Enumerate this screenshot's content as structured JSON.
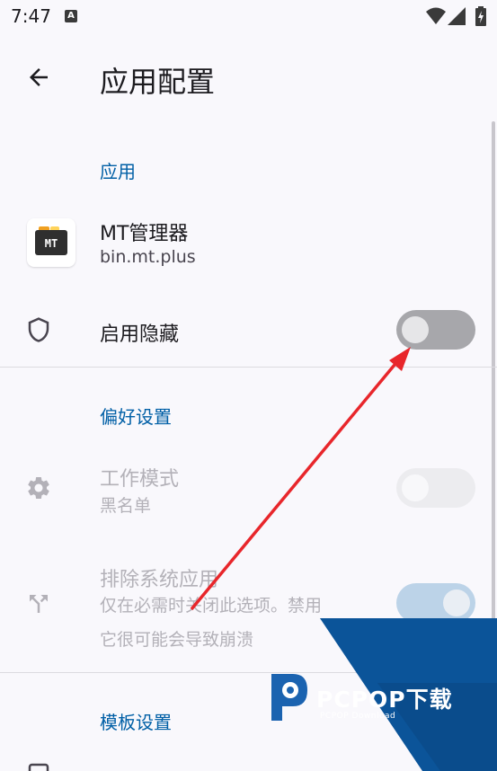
{
  "status_bar": {
    "time": "7:47",
    "notification_badge": "A"
  },
  "app_bar": {
    "title": "应用配置",
    "back_icon": "arrow-left-icon"
  },
  "sections": {
    "app": {
      "header": "应用",
      "app_name": "MT管理器",
      "package": "bin.mt.plus",
      "app_icon_text": "MT",
      "enable_hide": {
        "label": "启用隐藏",
        "icon": "shield-icon",
        "checked": false
      }
    },
    "preferences": {
      "header": "偏好设置",
      "work_mode": {
        "label": "工作模式",
        "value": "黑名单",
        "icon": "gear-icon",
        "checked": false,
        "enabled": false
      },
      "exclude_system": {
        "label": "排除系统应用",
        "description_line1": "仅在必需时关闭此选项。禁用",
        "description_line2": "它很可能会导致崩溃",
        "icon": "call-split-icon",
        "checked": true,
        "enabled": false
      }
    },
    "templates": {
      "header": "模板设置"
    }
  },
  "watermark": {
    "brand": "PCPOP下载",
    "sub": "PCPOP Download"
  },
  "colors": {
    "accent": "#005fa6",
    "annotation": "#e8262b",
    "watermark_blue": "#0b5499"
  }
}
